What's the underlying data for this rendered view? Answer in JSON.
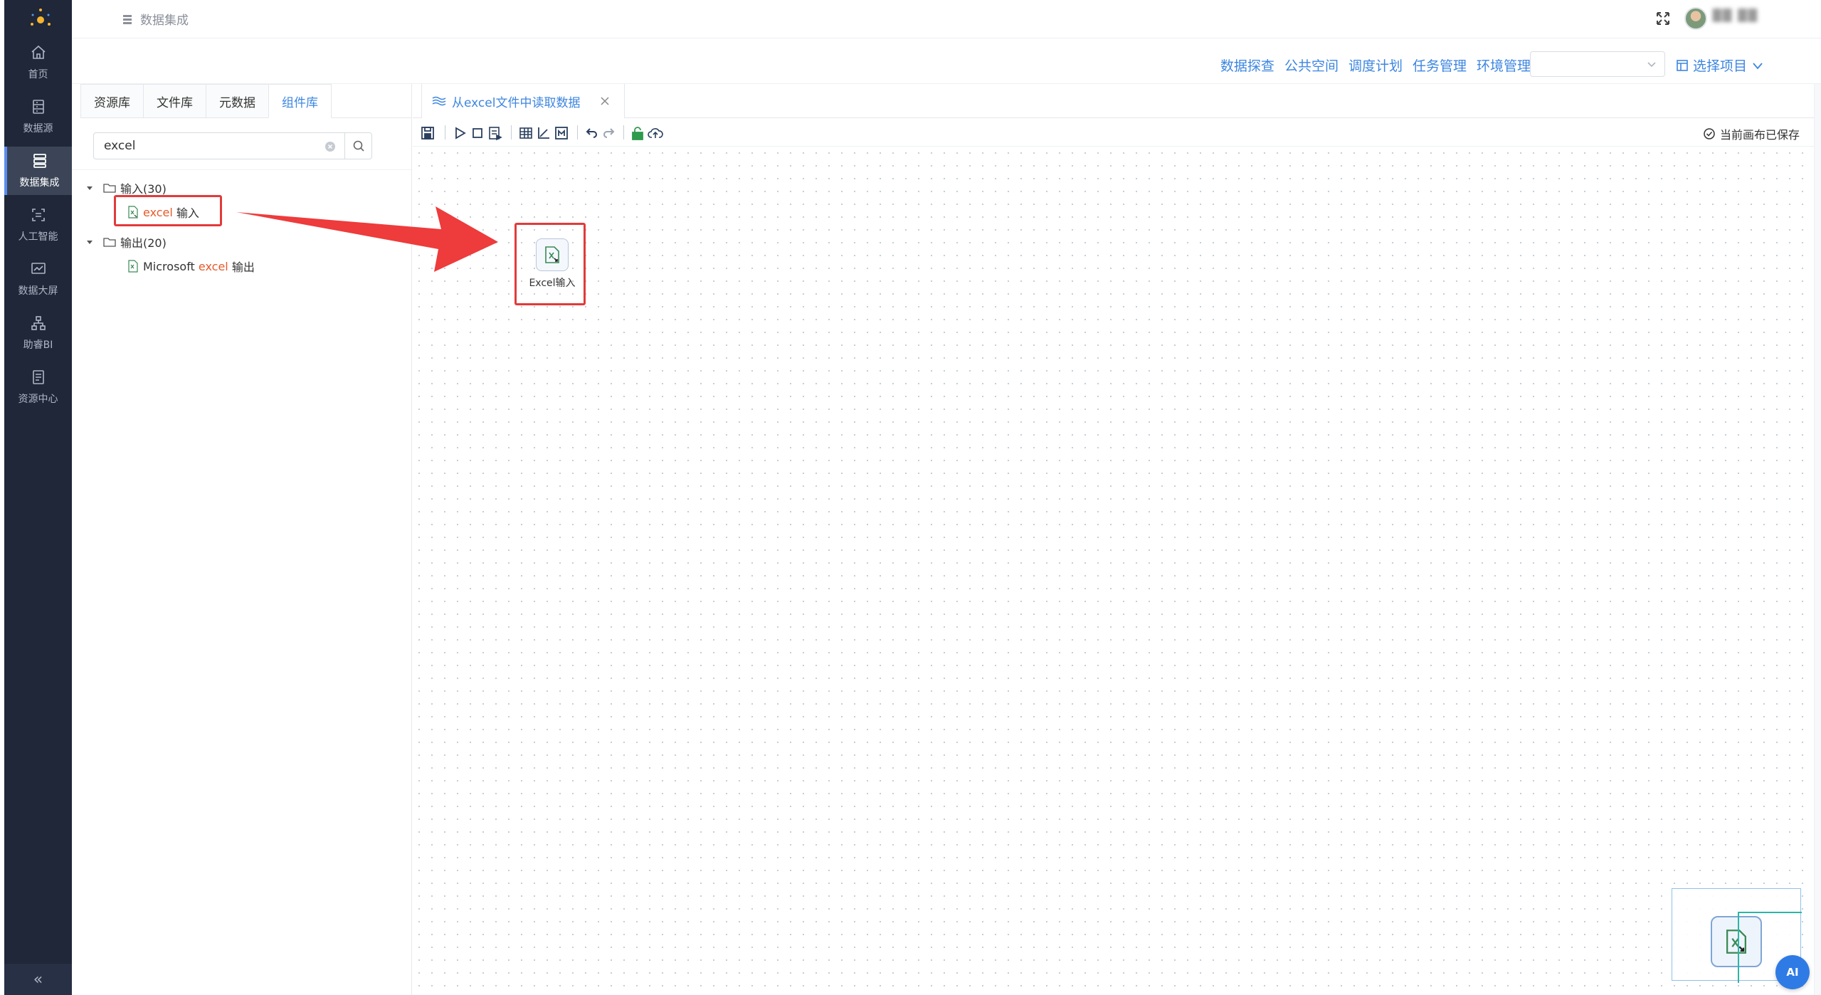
{
  "sidebar": {
    "items": [
      {
        "label": "首页",
        "icon": "home-icon"
      },
      {
        "label": "数据源",
        "icon": "database-icon"
      },
      {
        "label": "数据集成",
        "icon": "server-icon",
        "active": true
      },
      {
        "label": "人工智能",
        "icon": "ai-scan-icon"
      },
      {
        "label": "数据大屏",
        "icon": "chart-screen-icon"
      },
      {
        "label": "助睿BI",
        "icon": "org-chart-icon"
      },
      {
        "label": "资源中心",
        "icon": "resource-icon"
      }
    ],
    "collapse_label": "«"
  },
  "header": {
    "breadcrumb": "数据集成",
    "username": "██ ██"
  },
  "sub_header": {
    "menu": [
      "数据探查",
      "公共空间",
      "调度计划",
      "任务管理",
      "环境管理"
    ],
    "project_select_value": "",
    "choose_project": "选择项目"
  },
  "left_panel": {
    "tabs": [
      "资源库",
      "文件库",
      "元数据",
      "组件库"
    ],
    "active_tab": "组件库",
    "search": {
      "value": "excel",
      "placeholder": ""
    },
    "tree": {
      "input_group": {
        "label": "输入(30)"
      },
      "input_item": {
        "highlight": "excel",
        "rest": " 输入"
      },
      "output_group": {
        "label": "输出(20)"
      },
      "output_item": {
        "prefix": "Microsoft ",
        "highlight": "excel",
        "rest": " 输出"
      }
    }
  },
  "workspace": {
    "tab_title": "从excel文件中读取数据",
    "save_status": "当前画布已保存",
    "node_label": "Excel输入",
    "ai_label": "AI"
  },
  "colors": {
    "sidebar_bg": "#1f2738",
    "accent": "#3d86e0",
    "highlight": "#e55a2a",
    "annotation": "#e33a3a"
  }
}
